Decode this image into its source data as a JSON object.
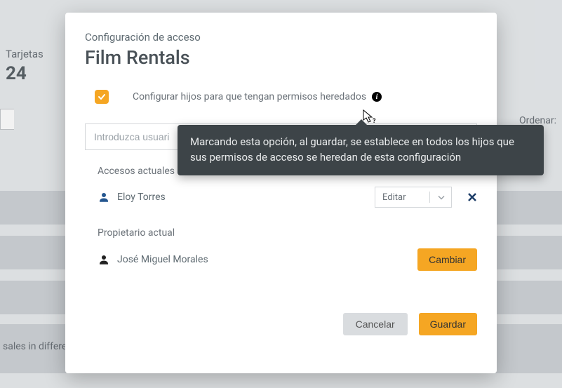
{
  "background": {
    "tarjetas_label": "Tarjetas",
    "count": "24",
    "ordenar": "Ordenar:",
    "sales_text": "sales in differe"
  },
  "modal": {
    "subtitle": "Configuración de acceso",
    "title": "Film Rentals",
    "inherit_label": "Configurar hijos para que tengan permisos heredados",
    "user_input_placeholder": "Introduzca usuari",
    "accesos_label": "Accesos actuales",
    "access_user": "Eloy Torres",
    "access_role": "Editar",
    "propietario_label": "Propietario actual",
    "owner_user": "José Miguel Morales",
    "cambiar": "Cambiar",
    "cancelar": "Cancelar",
    "guardar": "Guardar"
  },
  "tooltip": {
    "text": "Marcando esta opción, al guardar, se establece en todos los hijos que sus permisos de acceso se heredan de esta configuración"
  }
}
